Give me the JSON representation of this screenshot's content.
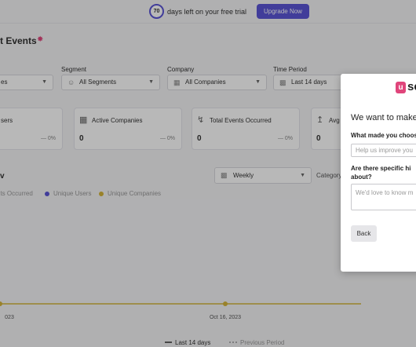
{
  "banner": {
    "days": "70",
    "text": "days left on your free trial",
    "upgrade": "Upgrade Now"
  },
  "page": {
    "title": "t Events"
  },
  "filters": [
    {
      "label": "",
      "value": "es"
    },
    {
      "label": "Segment",
      "value": "All Segments"
    },
    {
      "label": "Company",
      "value": "All Companies"
    },
    {
      "label": "Time Period",
      "value": "Last 14 days"
    }
  ],
  "cards": [
    {
      "label": "sers",
      "value": "",
      "pct": "— 0%"
    },
    {
      "label": "Active Companies",
      "value": "0",
      "pct": "— 0%"
    },
    {
      "label": "Total Events Occurred",
      "value": "0",
      "pct": "— 0%"
    },
    {
      "label": "Avg",
      "value": "0",
      "pct": ""
    }
  ],
  "chart_section": {
    "title": "v",
    "period": "Weekly",
    "category_label": "Category"
  },
  "chart_data": {
    "type": "line",
    "x": [
      "023",
      "Oct 16, 2023"
    ],
    "series": [
      {
        "name": "nts Occurred",
        "values": [
          0,
          0
        ],
        "color": "#5b55d6"
      },
      {
        "name": "Unique Users",
        "values": [
          0,
          0
        ],
        "color": "#5b55d6"
      },
      {
        "name": "Unique Companies",
        "values": [
          0,
          0
        ],
        "color": "#d4b43b"
      }
    ],
    "bottom_legend": [
      "Last 14 days",
      "Previous Period"
    ]
  },
  "modal": {
    "logo_u": "u",
    "logo_rest": "se",
    "heading": "We want to make U",
    "q1": "What made you choos",
    "input_placeholder": "Help us improve you",
    "q2_line1": "Are there specific hi",
    "q2_line2": "about?",
    "textarea_placeholder": "We'd love to know m",
    "back": "Back"
  }
}
